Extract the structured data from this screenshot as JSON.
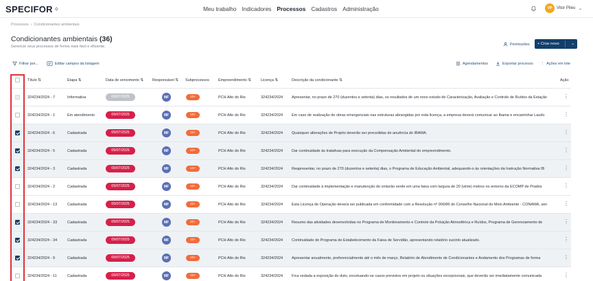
{
  "header": {
    "logo": "SPECIFOR",
    "logo_mark": "⁘",
    "nav": [
      "Meu trabalho",
      "Indicadores",
      "Processos",
      "Cadastros",
      "Administração"
    ],
    "active_nav": "Processos",
    "user_initials": "VP",
    "user_name": "Vitor Pileu"
  },
  "breadcrumb": [
    "Processos",
    "Condicionantes ambientais"
  ],
  "page": {
    "title": "Condicionantes ambientais",
    "count": "(36)",
    "subtitle": "Gerencie seus processos de forma mais fácil e eficiente.",
    "permissions_label": "Permissões",
    "create_label": "+ Criar novo"
  },
  "toolbar": {
    "filter_label": "Filtrar por...",
    "edit_fields_label": "Editar campos da listagem",
    "schedules_label": "Agendamentos",
    "export_label": "Exportar processo",
    "batch_label": "Ações em lote"
  },
  "table": {
    "columns": [
      "Título",
      "Etapa",
      "Data de vencimento",
      "Responsável",
      "Subprocessos",
      "Empreendimento",
      "Licença",
      "Descrição da condicionante",
      "Ação"
    ],
    "rows": [
      {
        "titulo": "324234/2024 - 7",
        "etapa": "Informativa",
        "data": "09/07/2025",
        "resp": "MF",
        "sub": "10+",
        "emp": "PCH Alto do Rio",
        "lic": "324234/2024",
        "desc": "Apresentar, no prazo de 270 (duzentos e setenta) dias, os resultados de um novo estudo de Caracterização, Avaliação e Controle de Ruídos da Estação",
        "checked": false,
        "disabled": true
      },
      {
        "titulo": "324234/2024 - 1",
        "etapa": "Em atendimento",
        "data": "09/07/2025",
        "resp": "MF",
        "sub": "10+",
        "emp": "PCH Alto do Rio",
        "lic": "324234/2024",
        "desc": "Em caso de realização de obras emergenciais nas estruturas abrangidas por esta licença, a empresa deverá comunicar ao Ibama e encaminhar Laudo",
        "checked": false,
        "disabled": false
      },
      {
        "titulo": "324234/2024 - 6",
        "etapa": "Cadastrada",
        "data": "09/07/2025",
        "resp": "MF",
        "sub": "10+",
        "emp": "PCH Alto do Rio",
        "lic": "324234/2024",
        "desc": "Quaisquer alterações de Projeto deverão ser precedidas de anuência do IBAMA.",
        "checked": true,
        "disabled": false
      },
      {
        "titulo": "324234/2024 - 5",
        "etapa": "Cadastrada",
        "data": "09/07/2025",
        "resp": "MF",
        "sub": "10+",
        "emp": "PCH Alto do Rio",
        "lic": "324234/2024",
        "desc": "Dar continuidade às tratativas para execução da Compensação Ambiental do empreendimento.",
        "checked": true,
        "disabled": false
      },
      {
        "titulo": "324234/2024 - 3",
        "etapa": "Cadastrada",
        "data": "09/07/2025",
        "resp": "MF",
        "sub": "10+",
        "emp": "PCH Alto do Rio",
        "lic": "324234/2024",
        "desc": "Reapresentar, no prazo de 270 (duzentos e setenta) dias, o Programa de Educação Ambiental, adequando-o às orientações da Instrução Normativa IB",
        "checked": true,
        "disabled": false
      },
      {
        "titulo": "324234/2024 - 2",
        "etapa": "Cadastrada",
        "data": "09/07/2025",
        "resp": "MF",
        "sub": "10+",
        "emp": "PCH Alto do Rio",
        "lic": "324234/2024",
        "desc": "Dar continuidade à implementação e manutenção do cinturão verde em uma faixa com largura de 20 (vinte) metros no entorno da ECOMP de Prados",
        "checked": false,
        "disabled": false
      },
      {
        "titulo": "324234/2024 - 13",
        "etapa": "Cadastrada",
        "data": "09/07/2025",
        "resp": "MF",
        "sub": "10+",
        "emp": "PCH Alto do Rio",
        "lic": "324234/2024",
        "desc": "Esta Licença de Operação deverá ser publicada em conformidade com a Resolução nº 006/86 do Conselho Nacional do Meio Ambiente - CONAMA, sen",
        "checked": false,
        "disabled": false
      },
      {
        "titulo": "324234/2024 - 33",
        "etapa": "Cadastrada",
        "data": "09/07/2025",
        "resp": "MF",
        "sub": "10+",
        "emp": "PCH Alto do Rio",
        "lic": "324234/2024",
        "desc": "Resumo das atividades desenvolvidas no Programa de Monitoramento e Controle da Poluição Atmosférica e Ruídos, Programa de Gerenciamento de",
        "checked": true,
        "disabled": false
      },
      {
        "titulo": "324234/2024 - 34",
        "etapa": "Cadastrada",
        "data": "09/07/2025",
        "resp": "MF",
        "sub": "10+",
        "emp": "PCH Alto do Rio",
        "lic": "324234/2024",
        "desc": "Continuidade do Programa de Estabelecimento da Faixa de Servidão, apresentando relatório sucinto atualizado.",
        "checked": true,
        "disabled": false
      },
      {
        "titulo": "324234/2024 - 9",
        "etapa": "Cadastrada",
        "data": "09/07/2025",
        "resp": "MF",
        "sub": "10+",
        "emp": "PCH Alto do Rio",
        "lic": "324234/2024",
        "desc": "Apresentar anualmente, preferencialmente até o mês de março, Relatório de Atendimento de Condicionantes e Andamento dos Programas de forma",
        "checked": true,
        "disabled": false
      },
      {
        "titulo": "324234/2024 - 11",
        "etapa": "Cadastrada",
        "data": "09/07/2025",
        "resp": "MF",
        "sub": "10+",
        "emp": "PCH Alto do Rio",
        "lic": "324234/2024",
        "desc": "Fica vedada a exposição do duto, excetuando-se casos previstos em projeto ou situações excepcionais, que deverão ser imediatamente comunicada",
        "checked": false,
        "disabled": false
      }
    ]
  },
  "colors": {
    "brand_navy": "#123f6b",
    "date_red": "#d6204a",
    "sub_orange": "#f36b3b",
    "avatar_blue": "#5a6fb5",
    "highlight_red": "#e0313a"
  }
}
